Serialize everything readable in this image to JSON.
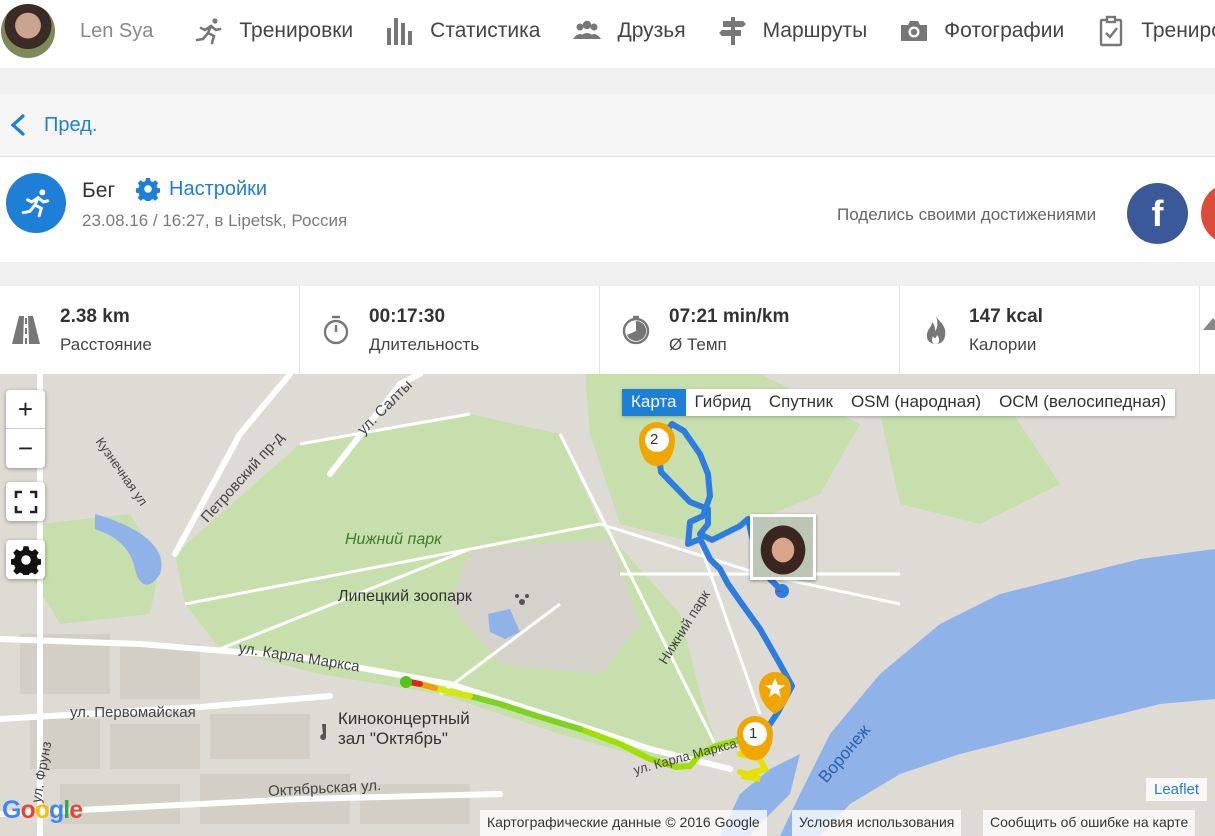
{
  "user": {
    "name": "Len Sya"
  },
  "nav": {
    "items": [
      {
        "label": "Тренировки",
        "icon": "runner-icon"
      },
      {
        "label": "Статистика",
        "icon": "bar-chart-icon"
      },
      {
        "label": "Друзья",
        "icon": "friends-icon"
      },
      {
        "label": "Маршруты",
        "icon": "signpost-icon"
      },
      {
        "label": "Фотографии",
        "icon": "camera-icon"
      },
      {
        "label": "Трениро",
        "icon": "checklist-icon"
      }
    ]
  },
  "back": {
    "label": "Пред."
  },
  "activity": {
    "sport": "Бег",
    "settings_label": "Настройки",
    "subtitle": "23.08.16 / 16:27, в Lipetsk, Россия",
    "share_text": "Поделись своими достижениями",
    "facebook_label": "f"
  },
  "stats": [
    {
      "value": "2.38 km",
      "label": "Расстояние",
      "icon": "road-icon"
    },
    {
      "value": "00:17:30",
      "label": "Длительность",
      "icon": "stopwatch-icon"
    },
    {
      "value": "07:21 min/km",
      "label": "Ø Темп",
      "icon": "pace-gauge-icon"
    },
    {
      "value": "147 kcal",
      "label": "Калории",
      "icon": "flame-icon"
    }
  ],
  "map": {
    "zoom_in": "+",
    "zoom_out": "−",
    "layers": [
      "Карта",
      "Гибрид",
      "Спутник",
      "OSM (народная)",
      "ОСМ (велосипедная)"
    ],
    "active_layer": "Карта",
    "labels": {
      "park": "Нижний парк",
      "zoo": "Липецкий зоопарк",
      "cinema_1": "Киноконцертный",
      "cinema_2": "зал \"Октябрь\"",
      "street_marx": "ул. Карла Маркса",
      "street_pervomay": "ул. Первомайская",
      "street_oktyabr": "Октябрьская ул.",
      "street_petrovsky": "Петровский пр-д",
      "street_kuznech": "Кузнечная ул",
      "street_salt": "ул. Салты",
      "street_park": "Нижний парк",
      "street_frunze": "ул. Фрунз",
      "street_karlamarksa2": "ул. Карла Маркса",
      "river": "Воронеж"
    },
    "markers": {
      "lap1": "1",
      "lap2": "2"
    },
    "leaflet": "Leaflet",
    "attribution": [
      "Картографические данные © 2016 Google",
      "Условия использования",
      "Сообщить об ошибке на карте"
    ],
    "google": "Google"
  },
  "colors": {
    "accent": "#1e7fd6",
    "route": "#2d7ce0",
    "facebook": "#3b5998",
    "marker": "#f0a500"
  }
}
